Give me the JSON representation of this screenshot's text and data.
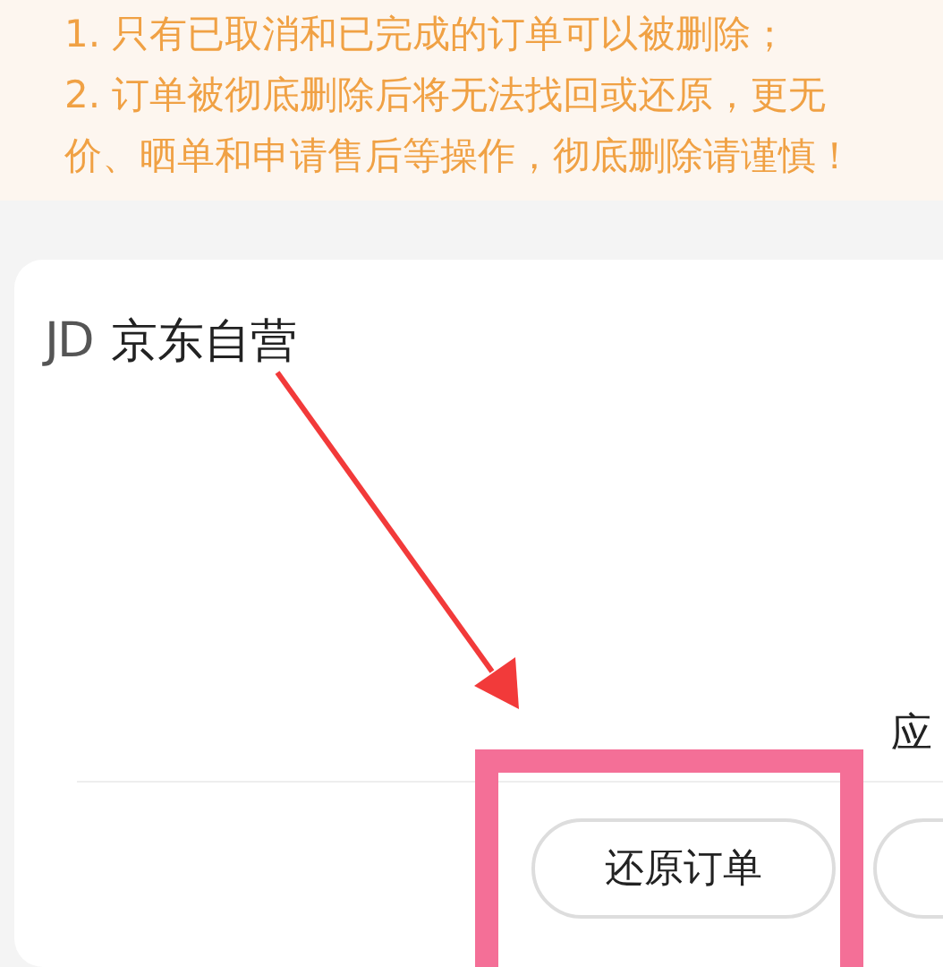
{
  "notice": {
    "lines": [
      "1. 只有已取消和已完成的订单可以被删除；",
      "2. 订单被彻底删除后将无法找回或还原，更无",
      "价、晒单和申请售后等操作，彻底删除请谨慎！"
    ]
  },
  "order": {
    "shop_logo": "JD",
    "shop_name": "京东自营",
    "amount_label": "应",
    "buttons": [
      {
        "label": "还原订单"
      }
    ]
  }
}
